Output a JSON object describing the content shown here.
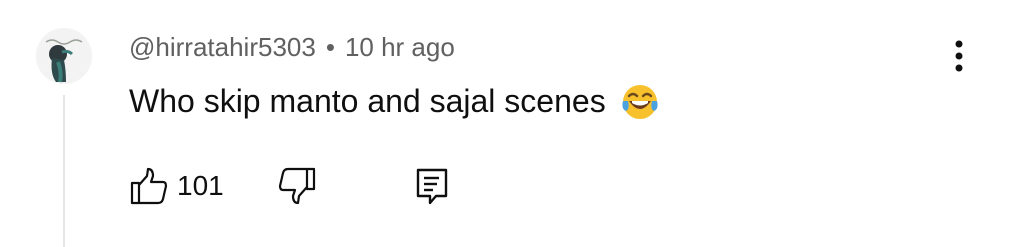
{
  "comment": {
    "author": "@hirratahir5303",
    "separator": "•",
    "timestamp": "10 hr ago",
    "text": "Who skip manto and sajal scenes",
    "emoji": "face-with-tears-of-joy",
    "like_count": "101"
  },
  "icons": {
    "more": "vertical-ellipsis-icon",
    "like": "thumbs-up-icon",
    "dislike": "thumbs-down-icon",
    "reply": "reply-comment-icon"
  },
  "colors": {
    "text_primary": "#0f0f0f",
    "text_secondary": "#606060",
    "thread_line": "#e6e6e6",
    "emoji_face": "#f7c12d",
    "emoji_tears": "#4aa3df"
  }
}
